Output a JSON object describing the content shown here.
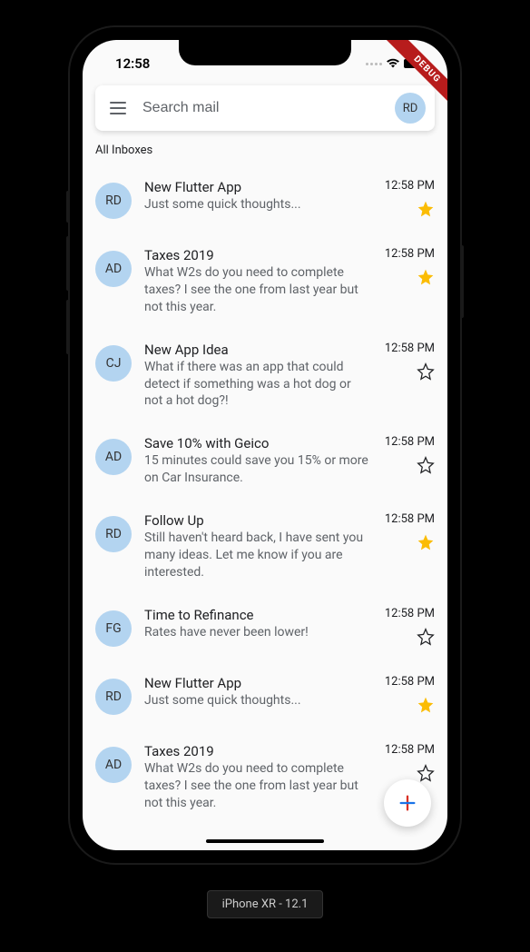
{
  "status": {
    "time": "12:58"
  },
  "debug_label": "DEBUG",
  "search": {
    "placeholder": "Search mail",
    "avatar_initials": "RD"
  },
  "section_label": "All Inboxes",
  "emails": [
    {
      "initials": "RD",
      "subject": "New Flutter App",
      "preview": "Just some quick thoughts...",
      "time": "12:58 PM",
      "starred": true
    },
    {
      "initials": "AD",
      "subject": "Taxes 2019",
      "preview": "What W2s do you need to complete taxes? I see the one from last year but not this year.",
      "time": "12:58 PM",
      "starred": true
    },
    {
      "initials": "CJ",
      "subject": "New App Idea",
      "preview": "What if there was an app that could detect if something was a hot dog or not a hot dog?!",
      "time": "12:58 PM",
      "starred": false
    },
    {
      "initials": "AD",
      "subject": "Save 10% with Geico",
      "preview": "15 minutes could save you 15% or more on Car Insurance.",
      "time": "12:58 PM",
      "starred": false
    },
    {
      "initials": "RD",
      "subject": "Follow Up",
      "preview": "Still haven't heard back, I have sent you many ideas. Let me know if you are interested.",
      "time": "12:58 PM",
      "starred": true
    },
    {
      "initials": "FG",
      "subject": "Time to Refinance",
      "preview": "Rates have never been lower!",
      "time": "12:58 PM",
      "starred": false
    },
    {
      "initials": "RD",
      "subject": "New Flutter App",
      "preview": "Just some quick thoughts...",
      "time": "12:58 PM",
      "starred": true
    },
    {
      "initials": "AD",
      "subject": "Taxes 2019",
      "preview": "What W2s do you need to complete taxes? I see the one from last year but not this year.",
      "time": "12:58 PM",
      "starred": false
    }
  ],
  "device_label": "iPhone XR - 12.1"
}
